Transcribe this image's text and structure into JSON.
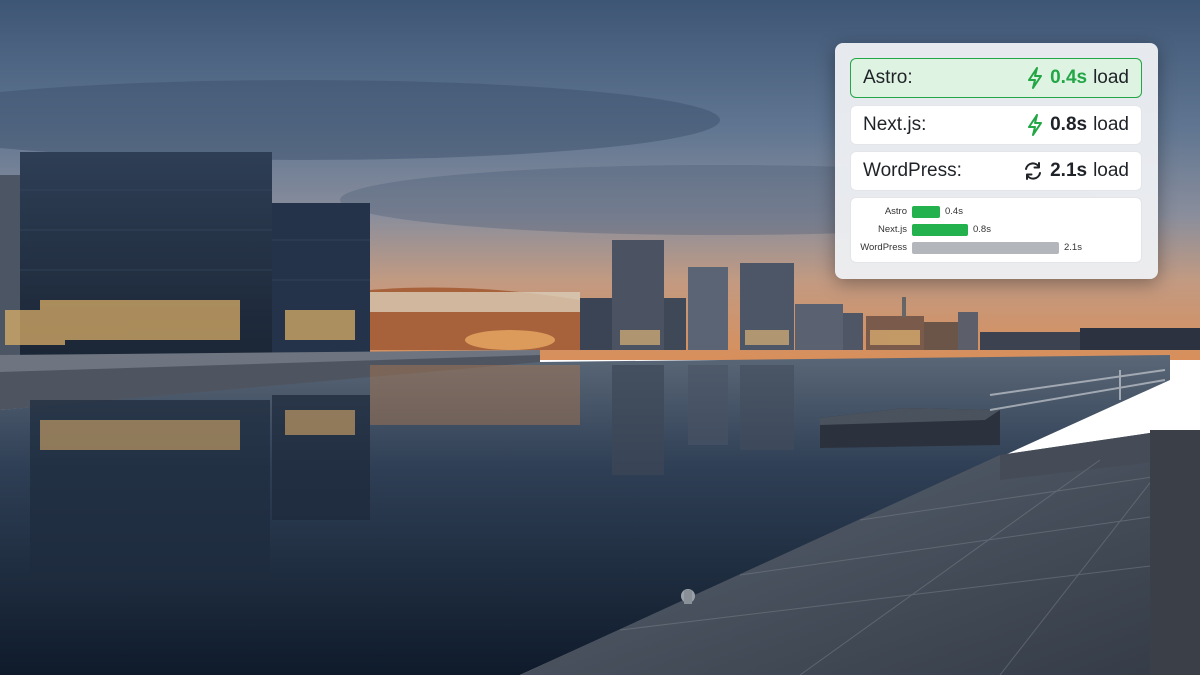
{
  "comparison": {
    "rows": [
      {
        "name": "Astro:",
        "time": "0.4s",
        "unit": "load",
        "icon": "lightning-icon",
        "highlight": true
      },
      {
        "name": "Next.js:",
        "time": "0.8s",
        "unit": "load",
        "icon": "lightning-icon",
        "highlight": false
      },
      {
        "name": "WordPress:",
        "time": "2.1s",
        "unit": "load",
        "icon": "refresh-icon",
        "highlight": false
      }
    ],
    "mini_chart": {
      "bars": [
        {
          "label": "Astro",
          "value": 0.4,
          "value_label": "0.4s",
          "color": "#22b14c"
        },
        {
          "label": "Next.js",
          "value": 0.8,
          "value_label": "0.8s",
          "color": "#22b14c"
        },
        {
          "label": "WordPress",
          "value": 2.1,
          "value_label": "2.1s",
          "color": "#b3b6ba"
        }
      ],
      "max": 2.1
    },
    "accent_color": "#22a646"
  }
}
